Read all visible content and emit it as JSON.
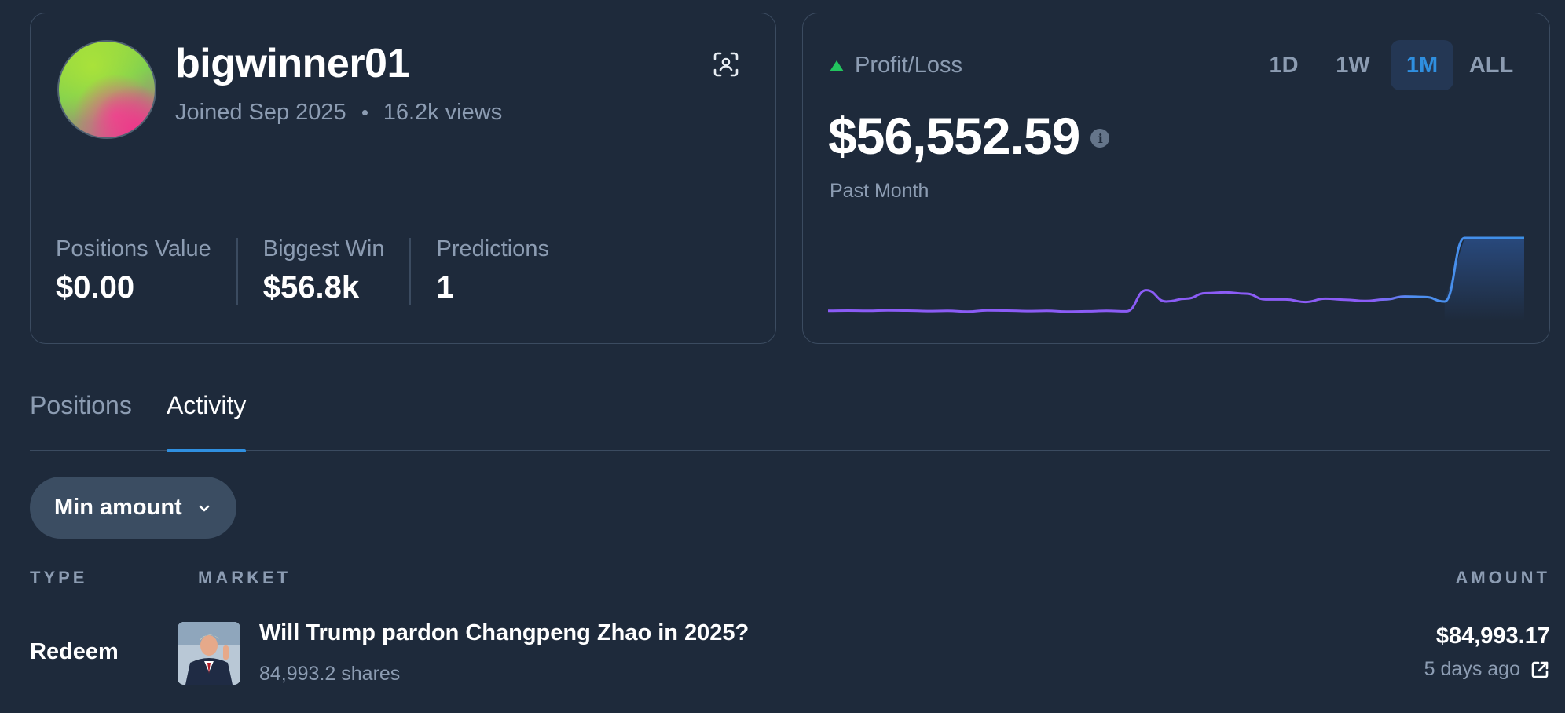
{
  "profile": {
    "username": "bigwinner01",
    "joined": "Joined Sep 2025",
    "views": "16.2k views",
    "avatar_icon": "gradient-avatar",
    "action_icon": "scan-profile-icon"
  },
  "stats": [
    {
      "label": "Positions Value",
      "value": "$0.00"
    },
    {
      "label": "Biggest Win",
      "value": "$56.8k"
    },
    {
      "label": "Predictions",
      "value": "1"
    }
  ],
  "pnl": {
    "label": "Profit/Loss",
    "value": "$56,552.59",
    "info_glyph": "i",
    "period": "Past Month",
    "trend_color": "#22c55e",
    "ranges": [
      "1D",
      "1W",
      "1M",
      "ALL"
    ],
    "active_range": "1M"
  },
  "chart_data": {
    "type": "line",
    "title": "",
    "xlabel": "",
    "ylabel": "",
    "x": [
      0,
      1,
      2,
      3,
      4,
      5,
      6,
      7,
      8,
      9,
      10,
      11,
      12,
      13,
      14,
      15,
      16,
      17,
      18,
      19,
      20,
      21,
      22,
      23,
      24,
      25,
      26,
      27,
      28,
      29,
      30,
      31,
      32,
      33,
      34,
      35
    ],
    "series": [
      {
        "values": [
          1000,
          1100,
          1000,
          1200,
          1100,
          900,
          1000,
          700,
          1200,
          1100,
          900,
          1000,
          700,
          800,
          1000,
          800,
          9200,
          4700,
          5800,
          8000,
          8300,
          7800,
          5500,
          5500,
          4500,
          5800,
          5400,
          4900,
          5500,
          6700,
          6500,
          4700,
          56552,
          56552,
          56552,
          56552
        ]
      }
    ],
    "line_colors": [
      "#8b5cf6",
      "#3b82f6"
    ],
    "grid": false,
    "legend": "none"
  },
  "tabs": [
    "Positions",
    "Activity"
  ],
  "active_tab": "Activity",
  "filter": {
    "label": "Min amount"
  },
  "table": {
    "headers": {
      "type": "TYPE",
      "market": "MARKET",
      "amount": "AMOUNT"
    },
    "rows": [
      {
        "type": "Redeem",
        "market": "Will Trump pardon Changpeng Zhao in 2025?",
        "shares": "84,993.2 shares",
        "amount": "$84,993.17",
        "time": "5 days ago"
      }
    ]
  }
}
